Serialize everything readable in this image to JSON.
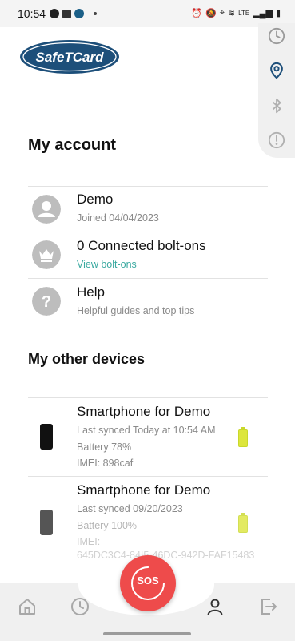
{
  "status_bar": {
    "time": "10:54",
    "network": "LTE"
  },
  "brand": {
    "logo_text": "SafeTCard"
  },
  "side_panel": {
    "icons": [
      "clock-icon",
      "location-pin-icon",
      "bluetooth-icon",
      "alert-icon"
    ]
  },
  "account": {
    "title": "My account",
    "profile": {
      "name": "Demo",
      "joined": "Joined 04/04/2023"
    },
    "boltons": {
      "title": "0 Connected bolt-ons",
      "link": "View bolt-ons"
    },
    "help": {
      "title": "Help",
      "subtitle": "Helpful guides and top tips"
    }
  },
  "devices": {
    "title": "My other devices",
    "items": [
      {
        "name": "Smartphone for Demo",
        "last_synced": "Last synced Today at 10:54 AM",
        "battery": "Battery 78%",
        "imei": "IMEI: 898caf"
      },
      {
        "name": "Smartphone for Demo",
        "last_synced": "Last synced 09/20/2023",
        "battery": "Battery 100%",
        "imei_label": "IMEI:",
        "imei": "645DC3C4-84I5-46DC-942D-FAF15483"
      }
    ]
  },
  "sos": {
    "label": "SOS"
  },
  "colors": {
    "brand_blue": "#1d4f7a",
    "accent_teal": "#3aa9a0",
    "sos_red": "#ee4b4b",
    "battery_green": "#dde63c"
  }
}
